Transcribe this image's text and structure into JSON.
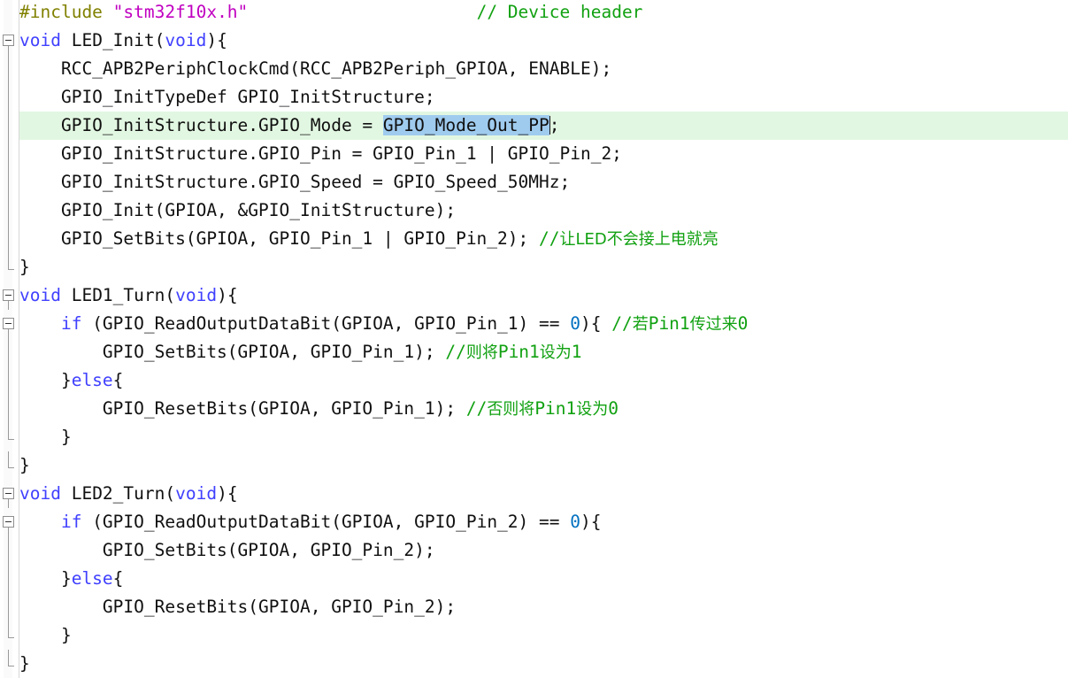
{
  "editor": {
    "language": "c",
    "theme": "light",
    "font_size_px": 19.5,
    "line_height_px": 32,
    "colors": {
      "background": "#ffffff",
      "foreground": "#101010",
      "preprocessor": "#808000",
      "string": "#c000c0",
      "keyword": "#4040ff",
      "number": "#0070c0",
      "comment": "#11a111",
      "current_line_highlight": "#e2f7e2",
      "selection": "#9fcbee",
      "gutter_border": "#d7d7d7",
      "fold_marker": "#8f8f8f"
    },
    "current_line_number": 5,
    "selection": {
      "text": "GPIO_Mode_Out_PP",
      "line_number": 5,
      "caret_after_selection": true
    }
  },
  "lines": [
    {
      "n": 1,
      "fold": "none",
      "segments": [
        {
          "t": "#include ",
          "c": "pre"
        },
        {
          "t": "\"stm32f10x.h\"",
          "c": "str"
        },
        {
          "t": "                      ",
          "c": "plain"
        },
        {
          "t": "// Device header",
          "c": "cmt"
        }
      ]
    },
    {
      "n": 2,
      "fold": "box",
      "segments": [
        {
          "t": "void",
          "c": "kw"
        },
        {
          "t": " LED_Init(",
          "c": "plain"
        },
        {
          "t": "void",
          "c": "kw"
        },
        {
          "t": "){",
          "c": "plain"
        }
      ]
    },
    {
      "n": 3,
      "fold": "line",
      "segments": [
        {
          "t": "    RCC_APB2PeriphClockCmd(RCC_APB2Periph_GPIOA, ENABLE);",
          "c": "plain"
        }
      ]
    },
    {
      "n": 4,
      "fold": "line",
      "segments": [
        {
          "t": "    GPIO_InitTypeDef GPIO_InitStructure;",
          "c": "plain"
        }
      ]
    },
    {
      "n": 5,
      "fold": "line",
      "current": true,
      "segments": [
        {
          "t": "    GPIO_InitStructure.GPIO_Mode = ",
          "c": "plain"
        },
        {
          "t": "GPIO_Mode_Out_PP",
          "c": "plain",
          "sel": true
        },
        {
          "t": ";",
          "c": "plain"
        }
      ]
    },
    {
      "n": 6,
      "fold": "line",
      "segments": [
        {
          "t": "    GPIO_InitStructure.GPIO_Pin = GPIO_Pin_1 | GPIO_Pin_2;",
          "c": "plain"
        }
      ]
    },
    {
      "n": 7,
      "fold": "line",
      "segments": [
        {
          "t": "    GPIO_InitStructure.GPIO_Speed = GPIO_Speed_50MHz;",
          "c": "plain"
        }
      ]
    },
    {
      "n": 8,
      "fold": "line",
      "segments": [
        {
          "t": "    GPIO_Init(GPIOA, &GPIO_InitStructure);",
          "c": "plain"
        }
      ]
    },
    {
      "n": 9,
      "fold": "line",
      "segments": [
        {
          "t": "    GPIO_SetBits(GPIOA, GPIO_Pin_1 | GPIO_Pin_2); ",
          "c": "plain"
        },
        {
          "t": "//",
          "c": "cmt"
        },
        {
          "t": "让LED不会接上电就亮",
          "c": "cmt",
          "cjk": true
        }
      ]
    },
    {
      "n": 10,
      "fold": "end",
      "segments": [
        {
          "t": "}",
          "c": "plain"
        }
      ]
    },
    {
      "n": 11,
      "fold": "box",
      "segments": [
        {
          "t": "void",
          "c": "kw"
        },
        {
          "t": " LED1_Turn(",
          "c": "plain"
        },
        {
          "t": "void",
          "c": "kw"
        },
        {
          "t": "){",
          "c": "plain"
        }
      ]
    },
    {
      "n": 12,
      "fold": "box-inner",
      "segments": [
        {
          "t": "    ",
          "c": "plain"
        },
        {
          "t": "if",
          "c": "kw"
        },
        {
          "t": " (GPIO_ReadOutputDataBit(GPIOA, GPIO_Pin_1) == ",
          "c": "plain"
        },
        {
          "t": "0",
          "c": "num"
        },
        {
          "t": "){ ",
          "c": "plain"
        },
        {
          "t": "//",
          "c": "cmt"
        },
        {
          "t": "若",
          "c": "cmt",
          "cjk": true
        },
        {
          "t": "Pin1",
          "c": "cmt"
        },
        {
          "t": "传过来",
          "c": "cmt",
          "cjk": true
        },
        {
          "t": "0",
          "c": "cmt"
        }
      ]
    },
    {
      "n": 13,
      "fold": "line-inner",
      "segments": [
        {
          "t": "        GPIO_SetBits(GPIOA, GPIO_Pin_1); ",
          "c": "plain"
        },
        {
          "t": "//",
          "c": "cmt"
        },
        {
          "t": "则将",
          "c": "cmt",
          "cjk": true
        },
        {
          "t": "Pin1",
          "c": "cmt"
        },
        {
          "t": "设为",
          "c": "cmt",
          "cjk": true
        },
        {
          "t": "1",
          "c": "cmt"
        }
      ]
    },
    {
      "n": 14,
      "fold": "line-inner",
      "segments": [
        {
          "t": "    }",
          "c": "plain"
        },
        {
          "t": "else",
          "c": "kw"
        },
        {
          "t": "{",
          "c": "plain"
        }
      ]
    },
    {
      "n": 15,
      "fold": "line-inner",
      "segments": [
        {
          "t": "        GPIO_ResetBits(GPIOA, GPIO_Pin_1); ",
          "c": "plain"
        },
        {
          "t": "//",
          "c": "cmt"
        },
        {
          "t": "否则将",
          "c": "cmt",
          "cjk": true
        },
        {
          "t": "Pin1",
          "c": "cmt"
        },
        {
          "t": "设为",
          "c": "cmt",
          "cjk": true
        },
        {
          "t": "0",
          "c": "cmt"
        }
      ]
    },
    {
      "n": 16,
      "fold": "end-inner",
      "segments": [
        {
          "t": "    }",
          "c": "plain"
        }
      ]
    },
    {
      "n": 17,
      "fold": "end",
      "segments": [
        {
          "t": "}",
          "c": "plain"
        }
      ]
    },
    {
      "n": 18,
      "fold": "box",
      "segments": [
        {
          "t": "void",
          "c": "kw"
        },
        {
          "t": " LED2_Turn(",
          "c": "plain"
        },
        {
          "t": "void",
          "c": "kw"
        },
        {
          "t": "){",
          "c": "plain"
        }
      ]
    },
    {
      "n": 19,
      "fold": "box-inner",
      "segments": [
        {
          "t": "    ",
          "c": "plain"
        },
        {
          "t": "if",
          "c": "kw"
        },
        {
          "t": " (GPIO_ReadOutputDataBit(GPIOA, GPIO_Pin_2) == ",
          "c": "plain"
        },
        {
          "t": "0",
          "c": "num"
        },
        {
          "t": "){",
          "c": "plain"
        }
      ]
    },
    {
      "n": 20,
      "fold": "line-inner",
      "segments": [
        {
          "t": "        GPIO_SetBits(GPIOA, GPIO_Pin_2);",
          "c": "plain"
        }
      ]
    },
    {
      "n": 21,
      "fold": "line-inner",
      "segments": [
        {
          "t": "    }",
          "c": "plain"
        },
        {
          "t": "else",
          "c": "kw"
        },
        {
          "t": "{",
          "c": "plain"
        }
      ]
    },
    {
      "n": 22,
      "fold": "line-inner",
      "segments": [
        {
          "t": "        GPIO_ResetBits(GPIOA, GPIO_Pin_2);",
          "c": "plain"
        }
      ]
    },
    {
      "n": 23,
      "fold": "end-inner",
      "segments": [
        {
          "t": "    }",
          "c": "plain"
        }
      ]
    },
    {
      "n": 24,
      "fold": "end",
      "segments": [
        {
          "t": "}",
          "c": "plain"
        }
      ]
    }
  ]
}
